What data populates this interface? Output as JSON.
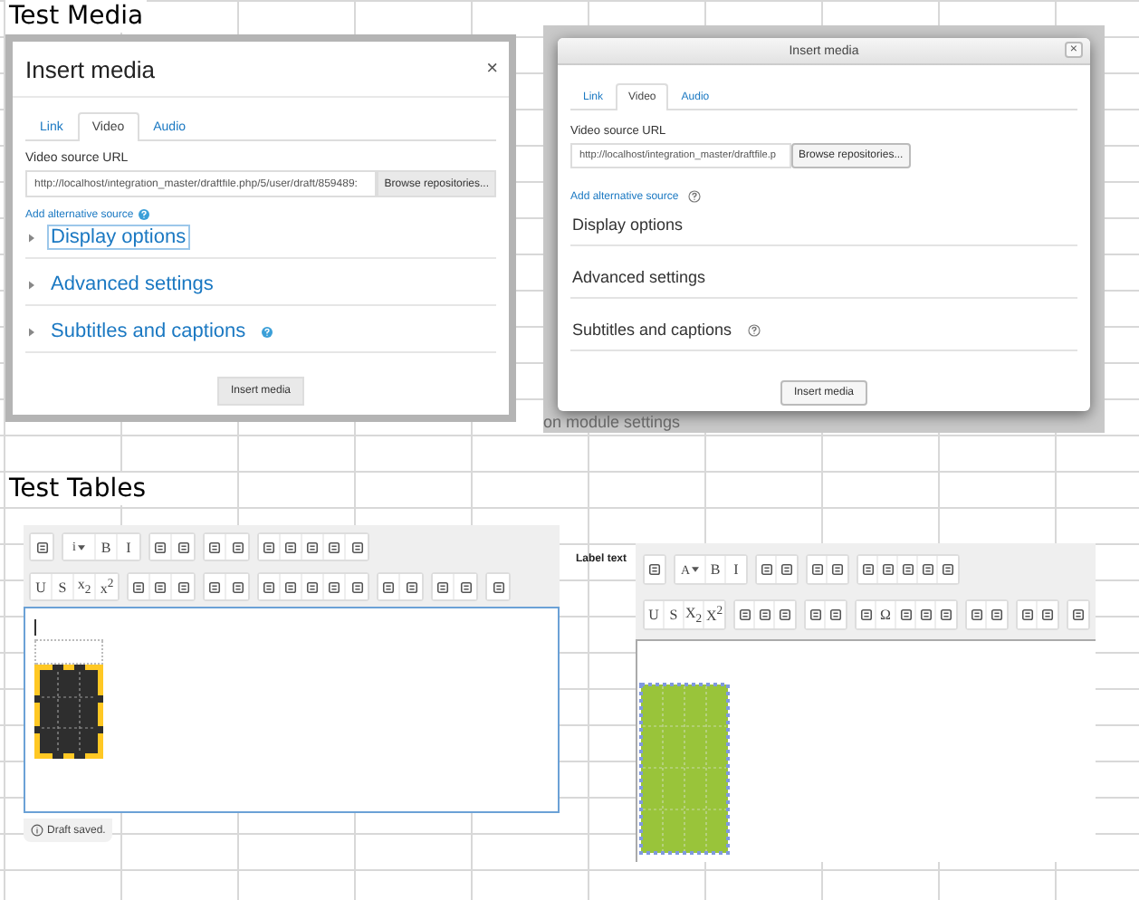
{
  "media_heading": "Test Media",
  "media_dialogs": [
    {
      "kind": "boxed",
      "title": "Insert media",
      "close": "×",
      "tabs": [
        {
          "label": "Link",
          "selected": false
        },
        {
          "label": "Video",
          "selected": true
        },
        {
          "label": "Audio",
          "selected": false
        }
      ],
      "url_label": "Video source URL",
      "url_value": "http://localhost/integration_master/draftfile.php/5/user/draft/859489:",
      "browse": "Browse repositories...",
      "alt_source": "Add alternative source",
      "sections": [
        {
          "label": "Display options",
          "focused": true,
          "help": false
        },
        {
          "label": "Advanced settings",
          "focused": false,
          "help": false
        },
        {
          "label": "Subtitles and captions",
          "focused": false,
          "help": true
        }
      ],
      "submit": "Insert media"
    },
    {
      "kind": "windowed",
      "title": "Insert media",
      "close": "×",
      "tabs": [
        {
          "label": "Link",
          "selected": false
        },
        {
          "label": "Video",
          "selected": true
        },
        {
          "label": "Audio",
          "selected": false
        }
      ],
      "url_label": "Video source URL",
      "url_value": "http://localhost/integration_master/draftfile.p",
      "browse": "Browse repositories...",
      "alt_source": "Add alternative source",
      "sections": [
        {
          "label": "Display options",
          "help": false
        },
        {
          "label": "Advanced settings",
          "help": false
        },
        {
          "label": "Subtitles and captions",
          "help": true
        }
      ],
      "submit": "Insert media",
      "background_text": "on module settings"
    }
  ],
  "tables_heading": "Test Tables",
  "editors": [
    {
      "kind": "atto",
      "status": "Draft saved.",
      "toolbar": [
        [
          [
            {
              "kind": "icon"
            }
          ],
          [
            {
              "kind": "dropdown",
              "label": "i"
            },
            {
              "kind": "glyph",
              "label": "B"
            },
            {
              "kind": "glyph",
              "label": "I"
            }
          ],
          [
            {
              "kind": "icon"
            },
            {
              "kind": "icon"
            }
          ],
          [
            {
              "kind": "icon"
            },
            {
              "kind": "icon"
            }
          ],
          [
            {
              "kind": "icon"
            },
            {
              "kind": "icon"
            },
            {
              "kind": "icon"
            },
            {
              "kind": "icon"
            },
            {
              "kind": "icon"
            }
          ]
        ],
        [
          [
            {
              "kind": "glyph",
              "label": "U"
            },
            {
              "kind": "glyph",
              "label": "S"
            },
            {
              "kind": "glyph",
              "label": "x$_{2}$"
            },
            {
              "kind": "glyph",
              "label": "x$^{2}$"
            }
          ],
          [
            {
              "kind": "icon"
            },
            {
              "kind": "icon"
            },
            {
              "kind": "icon"
            }
          ],
          [
            {
              "kind": "icon"
            },
            {
              "kind": "icon"
            }
          ],
          [
            {
              "kind": "icon"
            },
            {
              "kind": "icon"
            },
            {
              "kind": "icon"
            },
            {
              "kind": "icon"
            },
            {
              "kind": "icon"
            }
          ],
          [
            {
              "kind": "icon"
            },
            {
              "kind": "icon"
            }
          ],
          [
            {
              "kind": "icon"
            },
            {
              "kind": "icon"
            }
          ],
          [
            {
              "kind": "icon"
            }
          ]
        ]
      ]
    },
    {
      "kind": "tinymce",
      "label": "Label text",
      "toolbar": [
        [
          [
            {
              "kind": "icon"
            }
          ],
          [
            {
              "kind": "dropdown",
              "label": "A"
            },
            {
              "kind": "glyph",
              "label": "B"
            },
            {
              "kind": "glyph",
              "label": "I"
            }
          ],
          [
            {
              "kind": "icon"
            },
            {
              "kind": "icon"
            }
          ],
          [
            {
              "kind": "icon"
            },
            {
              "kind": "icon"
            }
          ],
          [
            {
              "kind": "icon"
            },
            {
              "kind": "icon"
            },
            {
              "kind": "icon"
            },
            {
              "kind": "icon"
            },
            {
              "kind": "icon"
            }
          ]
        ],
        [
          [
            {
              "kind": "glyph",
              "label": "U"
            },
            {
              "kind": "glyph",
              "label": "S"
            },
            {
              "kind": "glyph",
              "label": "X$_{2}$"
            },
            {
              "kind": "glyph",
              "label": "X$^{2}$"
            }
          ],
          [
            {
              "kind": "icon"
            },
            {
              "kind": "icon"
            },
            {
              "kind": "icon"
            }
          ],
          [
            {
              "kind": "icon"
            },
            {
              "kind": "icon"
            }
          ],
          [
            {
              "kind": "icon"
            },
            {
              "kind": "glyph",
              "label": "Ω"
            },
            {
              "kind": "icon"
            },
            {
              "kind": "icon"
            },
            {
              "kind": "icon"
            }
          ],
          [
            {
              "kind": "icon"
            },
            {
              "kind": "icon"
            }
          ],
          [
            {
              "kind": "icon"
            },
            {
              "kind": "icon"
            }
          ],
          [
            {
              "kind": "icon"
            }
          ]
        ]
      ]
    }
  ]
}
